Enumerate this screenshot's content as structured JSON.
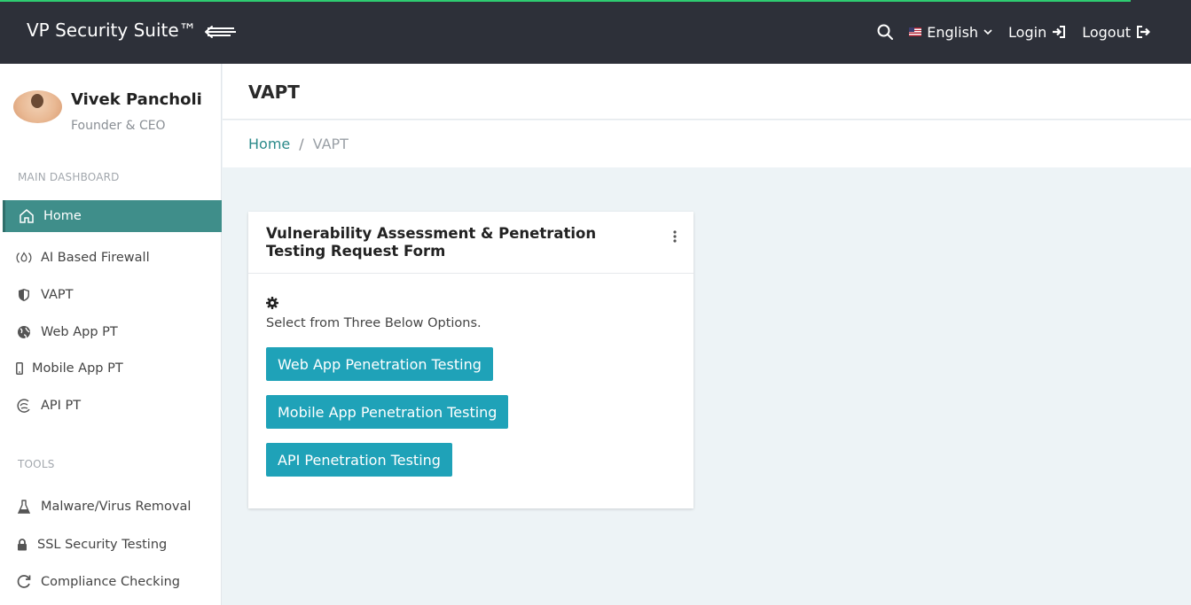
{
  "header": {
    "brand": "VP Security Suite™",
    "language": "English",
    "login_label": "Login",
    "logout_label": "Logout"
  },
  "user": {
    "name": "Vivek Pancholi",
    "role": "Founder & CEO"
  },
  "sidebar": {
    "main_section_label": "MAIN DASHBOARD",
    "main_items": [
      {
        "label": "Home",
        "icon": "home-icon",
        "active": true
      },
      {
        "label": "AI Based Firewall",
        "icon": "fire-icon"
      },
      {
        "label": "VAPT",
        "icon": "shield-icon"
      },
      {
        "label": "Web App PT",
        "icon": "globe-icon"
      },
      {
        "label": "Mobile App PT",
        "icon": "mobile-icon"
      },
      {
        "label": "API PT",
        "icon": "api-icon"
      }
    ],
    "tools_section_label": "TOOLS",
    "tool_items": [
      {
        "label": "Malware/Virus Removal",
        "icon": "flask-icon"
      },
      {
        "label": "SSL Security Testing",
        "icon": "lock-icon"
      },
      {
        "label": "Compliance Checking",
        "icon": "refresh-icon"
      }
    ]
  },
  "page": {
    "title": "VAPT",
    "breadcrumb": {
      "home": "Home",
      "separator": "/",
      "current": "VAPT"
    }
  },
  "card": {
    "title": "Vulnerability Assessment & Penetration Testing Request Form",
    "instruction": "Select from Three Below Options.",
    "buttons": [
      "Web App Penetration Testing",
      "Mobile App Penetration Testing",
      "API Penetration Testing"
    ]
  },
  "colors": {
    "topbar": "#2d3039",
    "accent_active": "#3f8e8a",
    "button": "#1fa2b8",
    "progress": "#2ecc71"
  }
}
